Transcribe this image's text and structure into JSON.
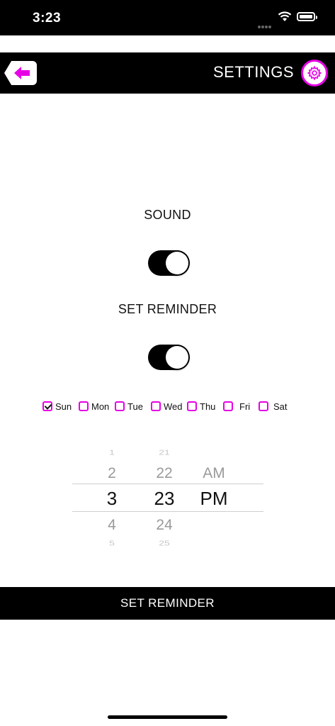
{
  "status_bar": {
    "time": "3:23"
  },
  "header": {
    "title": "SETTINGS"
  },
  "sound": {
    "label": "SOUND",
    "enabled": true
  },
  "reminder": {
    "label": "SET REMINDER",
    "enabled": true
  },
  "days": [
    {
      "label": "Sun",
      "checked": true
    },
    {
      "label": "Mon",
      "checked": false
    },
    {
      "label": "Tue",
      "checked": false
    },
    {
      "label": "Wed",
      "checked": false
    },
    {
      "label": "Thu",
      "checked": false
    },
    {
      "label": "Fri",
      "checked": false
    },
    {
      "label": "Sat",
      "checked": false
    }
  ],
  "time_picker": {
    "hours": [
      "1",
      "2",
      "3",
      "4",
      "5"
    ],
    "minutes": [
      "21",
      "22",
      "23",
      "24",
      "25"
    ],
    "ampm": [
      "AM",
      "PM"
    ],
    "selected": {
      "hour": "3",
      "minute": "23",
      "ampm": "PM"
    }
  },
  "set_reminder_button": {
    "label": "SET REMINDER"
  },
  "colors": {
    "accent": "#e600e6",
    "bar": "#000000",
    "background": "#ffffff"
  }
}
